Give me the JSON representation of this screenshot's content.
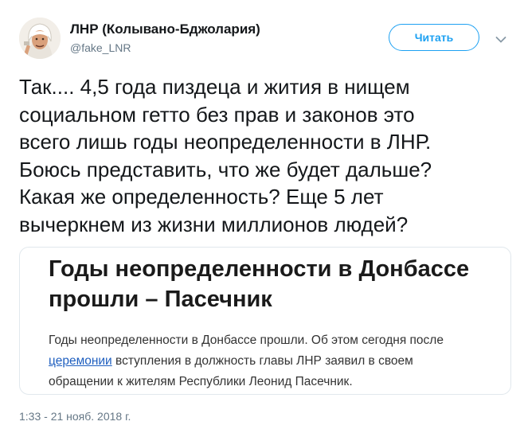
{
  "author": {
    "name": "ЛНР (Колывано-Бджолария)",
    "handle": "@fake_LNR",
    "avatar_icon": "avatar-man-headscarf-icon"
  },
  "follow_button": {
    "label": "Читать",
    "color": "#1da1f2"
  },
  "menu_icon": "chevron-down-icon",
  "tweet": {
    "lines": [
      "Так.... 4,5 года пиздеца и жития в нищем",
      "социальном гетто без прав и законов это",
      "всего лишь годы неопределенности в ЛНР.",
      "Боюсь представить, что же будет дальше?",
      "Какая же определенность? Еще 5 лет",
      "вычеркнем из жизни миллионов людей?"
    ]
  },
  "card": {
    "title_lines": [
      "Годы неопределенности в Донбассе",
      "прошли – Пасечник"
    ],
    "desc_line1": "Годы неопределенности в Донбассе прошли. Об этом сегодня после",
    "desc_link": "церемонии",
    "desc_line2_rest": " вступления в должность главы ЛНР заявил в своем",
    "desc_line3": "обращении к жителям Республики Леонид Пасечник."
  },
  "timestamp": "1:33 - 21 нояб. 2018 г."
}
